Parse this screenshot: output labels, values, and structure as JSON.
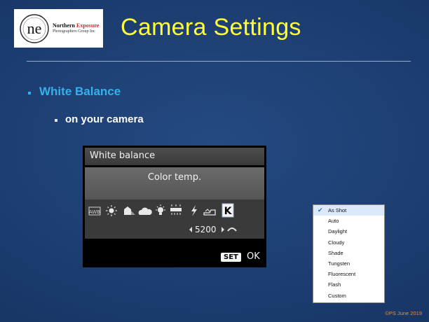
{
  "logo": {
    "mark": "ne",
    "line1_a": "Northern",
    "line1_b": "Exposure",
    "line2": "Photographers Group Inc"
  },
  "slide": {
    "title": "Camera Settings",
    "bullet1": "White Balance",
    "bullet2": "on your camera",
    "footer": "©PS June 2019"
  },
  "camera_screen": {
    "header": "White balance",
    "mode": "Color temp.",
    "awb_label": "AWB",
    "k_label": "K",
    "value": "5200",
    "set_label": "SET",
    "ok_label": "OK"
  },
  "wb_menu": {
    "items": [
      "As Shot",
      "Auto",
      "Daylight",
      "Cloudy",
      "Shade",
      "Tungsten",
      "Fluorescent",
      "Flash",
      "Custom"
    ],
    "selected": "As Shot"
  },
  "colors": {
    "title": "#ffff3a",
    "bullet1": "#35b0ea",
    "footer": "#f28c28",
    "background": "#1a3a6c"
  }
}
